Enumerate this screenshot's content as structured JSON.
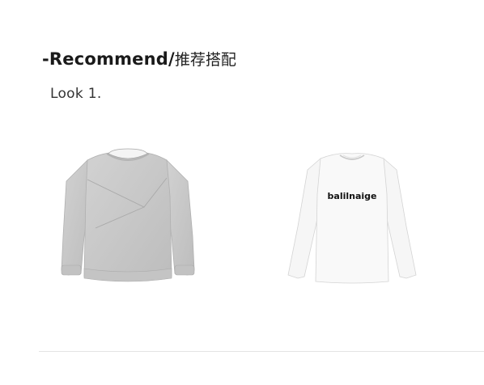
{
  "heading": {
    "english": "-Recommend/",
    "chinese": "推荐搭配"
  },
  "look": {
    "label": "Look 1."
  },
  "products": [
    {
      "name": "grey-sweatshirt",
      "color": "#c9c9c9"
    },
    {
      "name": "white-long-sleeve-tee",
      "color": "#f7f7f7",
      "print_text": "balilnaige"
    }
  ]
}
